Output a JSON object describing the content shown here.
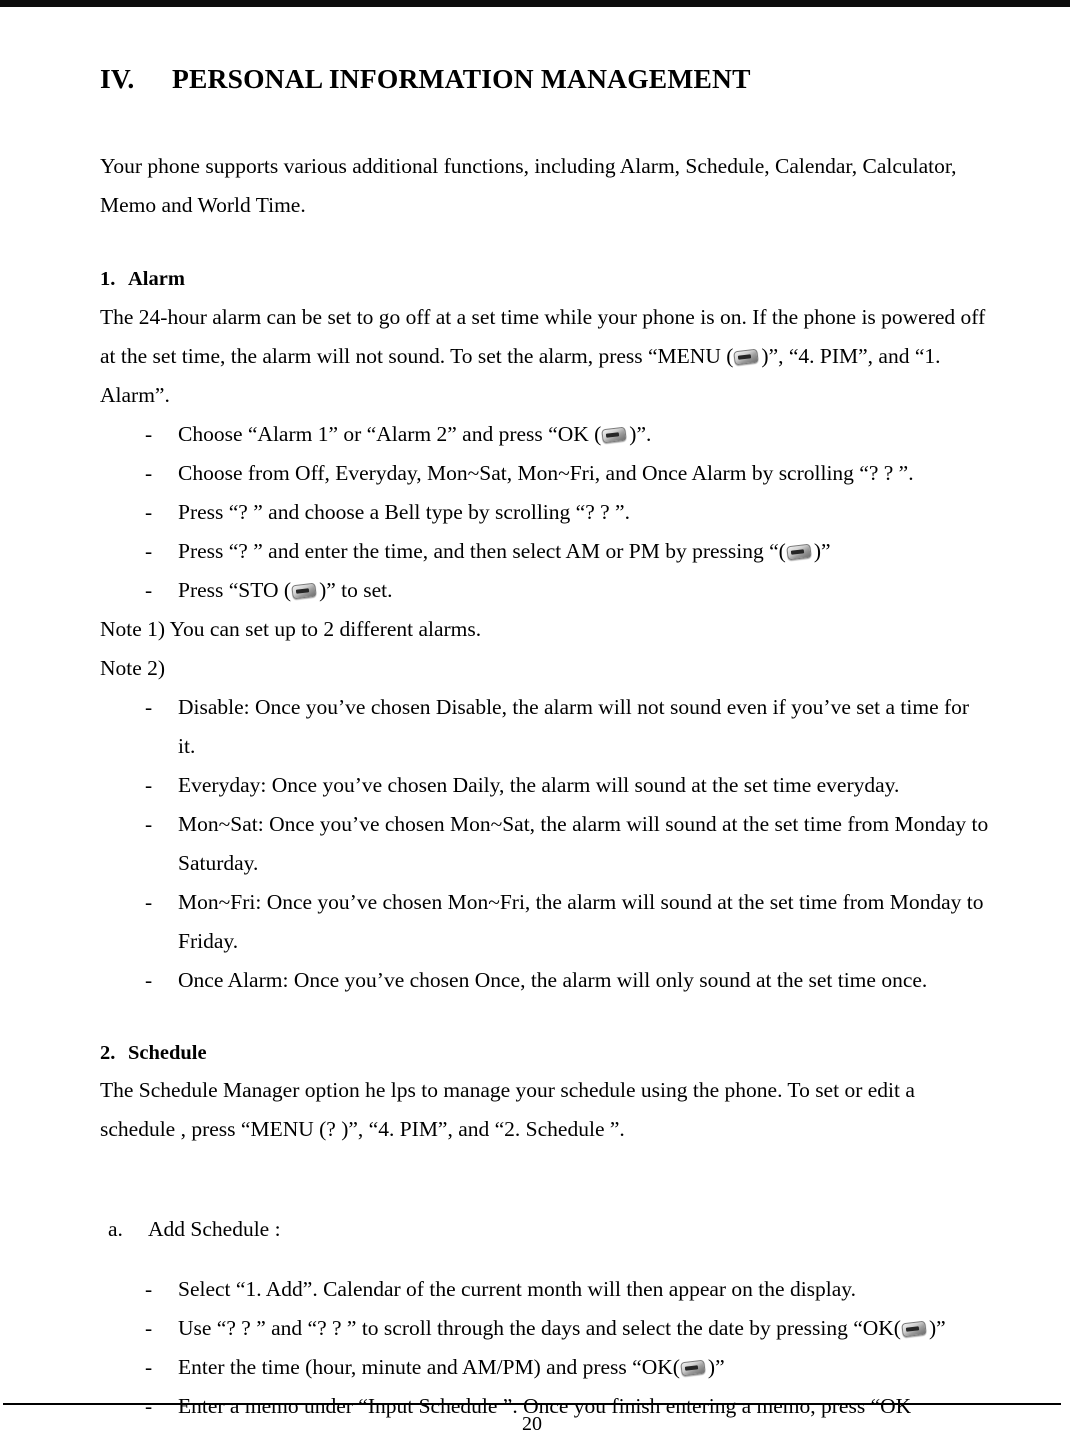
{
  "document": {
    "chapter": {
      "numeral": "IV.",
      "title": "PERSONAL INFORMATION MANAGEMENT"
    },
    "intro": "Your phone supports various additional functions, including Alarm, Schedule, Calendar, Calculator, Memo and World Time.",
    "sections": [
      {
        "numeral": "1.",
        "title": "Alarm",
        "body_before": "The 24-hour alarm can be set to go off at a set time while your phone is on. If the phone is powered off at the set time, the alarm will not sound. To set the alarm, press “MENU (",
        "body_after": ")”, “4. PIM”, and “1. Alarm”.",
        "steps": [
          {
            "dash": "-",
            "before": "Choose “Alarm 1” or “Alarm 2” and press “OK (",
            "after": ")”.",
            "has_icon": true
          },
          {
            "dash": "-",
            "text": "Choose from Off, Everyday, Mon~Sat, Mon~Fri, and Once Alarm by scrolling “?  ?  ”.",
            "has_icon": false
          },
          {
            "dash": "-",
            "text": "Press “?  ” and choose a Bell type by scrolling “?  ?  ”.",
            "has_icon": false
          },
          {
            "dash": "-",
            "before": "Press “?  ” and enter the time, and then select AM or PM by pressing “(",
            "after": ")”",
            "has_icon": true
          },
          {
            "dash": "-",
            "before": "Press “STO (",
            "after": ")” to set.",
            "has_icon": true
          }
        ],
        "note1": "Note 1) You can set up to 2 different alarms.",
        "note2_label": "Note 2)",
        "note2_items": [
          {
            "dash": "-",
            "text": "Disable: Once you’ve chosen Disable, the alarm will not sound even if you’ve set a time for it."
          },
          {
            "dash": "-",
            "text": "Everyday: Once you’ve chosen Daily, the alarm will sound at the set time everyday."
          },
          {
            "dash": "-",
            "text": "Mon~Sat: Once you’ve chosen Mon~Sat, the alarm will sound at the set time from Monday to Saturday."
          },
          {
            "dash": "-",
            "text": "Mon~Fri: Once you’ve chosen Mon~Fri, the alarm will sound at the set time from Monday to Friday."
          },
          {
            "dash": "-",
            "text": "Once Alarm: Once you’ve chosen Once, the alarm will only sound at the set time once."
          }
        ]
      },
      {
        "numeral": "2.",
        "title": "Schedule",
        "body": "The Schedule Manager option he lps to manage your schedule using the phone. To set or edit a schedule , press “MENU (?  )”, “4. PIM”, and “2. Schedule ”.",
        "subsection": {
          "marker": "a.",
          "title": "Add Schedule :",
          "steps": [
            {
              "dash": "-",
              "text": "Select “1. Add”. Calendar of the current month will then appear on the display.",
              "has_icon": false
            },
            {
              "dash": "-",
              "before": "Use “?  ?  ” and “?  ?  ” to scroll through the days and select the date by pressing “OK(",
              "after": ")”",
              "has_icon": true
            },
            {
              "dash": "-",
              "before": "Enter the time (hour, minute and AM/PM) and press “OK(",
              "after": ")”",
              "has_icon": true
            },
            {
              "dash": "-",
              "text": "Enter a memo under “Input Schedule ”. Once you finish entering a memo, press “OK",
              "has_icon": false
            }
          ]
        }
      }
    ],
    "footer": {
      "page_number": "20"
    }
  }
}
